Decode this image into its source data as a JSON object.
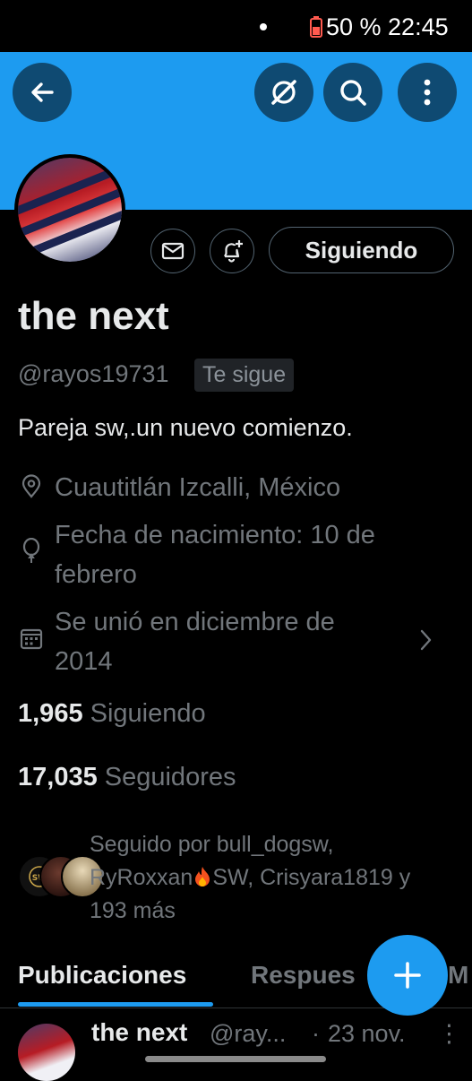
{
  "status_bar": {
    "battery_time": "50 % 22:45"
  },
  "header": {
    "back": "arrow-left-icon",
    "actions": [
      "grok-icon",
      "search-icon",
      "more-icon"
    ]
  },
  "profile": {
    "name": "the next",
    "handle": "@rayos19731",
    "follows_you": "Te sigue",
    "follow_button": "Siguiendo",
    "bio": "Pareja sw,.un nuevo comienzo.",
    "location": "Cuautitlán Izcalli, México",
    "birthday_line1": "Fecha de nacimiento: 10 de",
    "birthday_line2": "febrero",
    "joined_line1": "Se unió en diciembre de",
    "joined_line2": "2014",
    "following_count": "1,965",
    "following_label": "Siguiendo",
    "followers_count": "17,035",
    "followers_label": "Seguidores",
    "followed_by_line1": "Seguido por bull_dogsw,",
    "followed_by_line2a": "RyRoxxan",
    "followed_by_line2b": "SW, Crisyara1819 y",
    "followed_by_line3": "193 más"
  },
  "tabs": [
    "Publicaciones",
    "Respues",
    "M"
  ],
  "fab": "plus-icon",
  "tweet": {
    "name": "the next",
    "handle": "@ray...",
    "sep": "·",
    "date": "23 nov.",
    "more": "⋮"
  },
  "colors": {
    "accent": "#1d9bf0",
    "background": "#000000",
    "muted": "#71767b",
    "text": "#e7e9ea"
  }
}
